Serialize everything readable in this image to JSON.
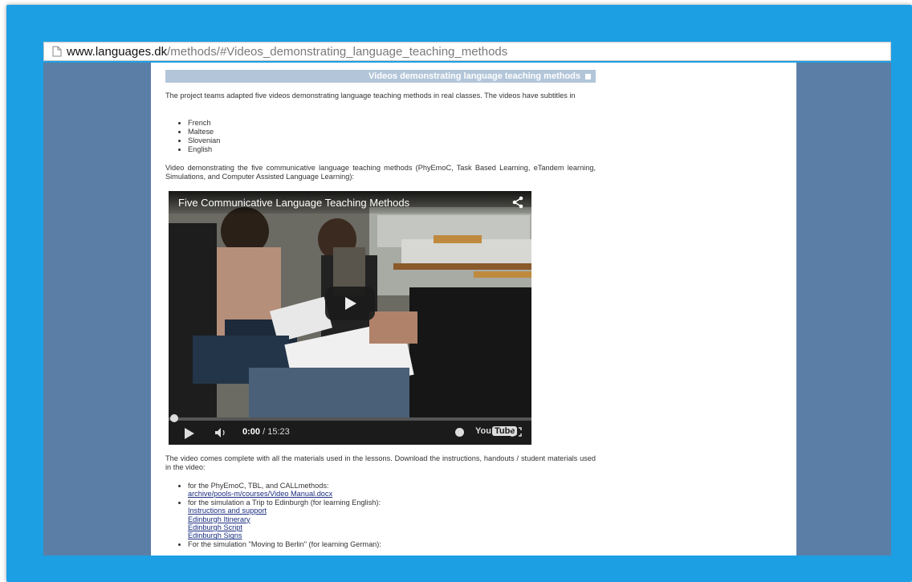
{
  "browser": {
    "url_host": "www.languages.dk",
    "url_path": "/methods/#Videos_demonstrating_language_teaching_methods"
  },
  "section": {
    "heading": "Videos demonstrating language teaching methods",
    "intro": "The project teams adapted five videos demonstrating language teaching methods in real classes. The videos have subtitles in",
    "languages": [
      "French",
      "Maltese",
      "Slovenian",
      "English"
    ],
    "video_desc": "Video demonstrating the five communicative language teaching methods (PhyEmoC, Task Based Learning, eTandem learning, Simulations, and Computer Assisted Language Learning):"
  },
  "video": {
    "title": "Five Communicative Language Teaching Methods",
    "current_time": "0:00",
    "duration": "/ 15:23",
    "progress": 0,
    "logo_you": "You",
    "logo_tube": "Tube"
  },
  "materials": {
    "intro": "The video comes complete with all the materials used in the lessons. Download the instructions, handouts / student materials used in the video:",
    "item1_text": "for the PhyEmoC, TBL, and CALLmethods:",
    "item1_link": "archive/pools-m/courses/Video Manual.docx",
    "item2_text": "for the simulation a Trip to Edinburgh (for learning English):",
    "item2_links": [
      "Instructions and support",
      "Edinburgh Itinerary",
      "Edinburgh Script",
      "Edinburgh Signs"
    ],
    "item3_text": "For the simulation \"Moving to Berlin\" (for learning German):"
  },
  "colors": {
    "frame": "#1d9fe4",
    "page_bg": "#5b7ea6",
    "heading_bar": "#b3c6d9",
    "link": "#1a2d80"
  }
}
